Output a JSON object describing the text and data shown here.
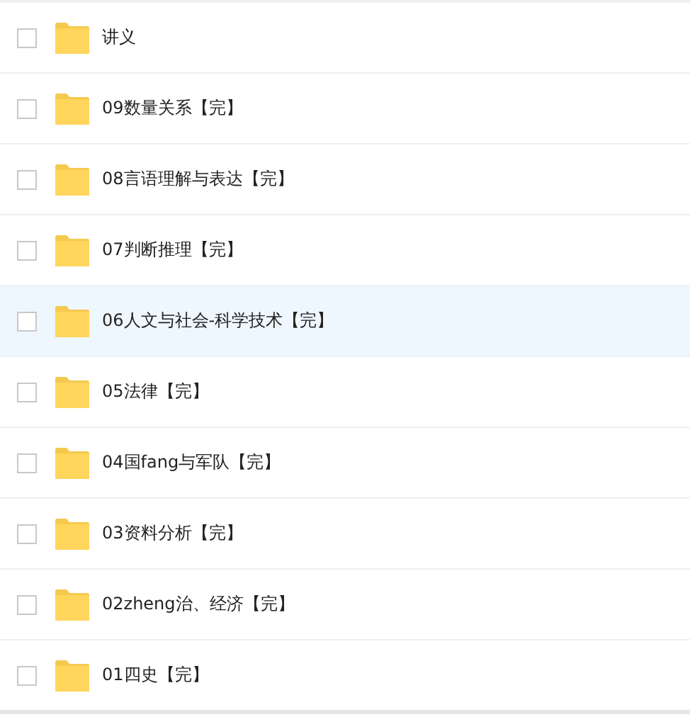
{
  "files": [
    {
      "name": "讲义",
      "checked": false,
      "highlighted": false
    },
    {
      "name": "09数量关系【完】",
      "checked": false,
      "highlighted": false
    },
    {
      "name": "08言语理解与表达【完】",
      "checked": false,
      "highlighted": false
    },
    {
      "name": "07判断推理【完】",
      "checked": false,
      "highlighted": false
    },
    {
      "name": "06人文与社会-科学技术【完】",
      "checked": false,
      "highlighted": true
    },
    {
      "name": "05法律【完】",
      "checked": false,
      "highlighted": false
    },
    {
      "name": "04国fang与军队【完】",
      "checked": false,
      "highlighted": false
    },
    {
      "name": "03资料分析【完】",
      "checked": false,
      "highlighted": false
    },
    {
      "name": "02zheng治、经济【完】",
      "checked": false,
      "highlighted": false
    },
    {
      "name": "01四史【完】",
      "checked": false,
      "highlighted": false
    }
  ]
}
